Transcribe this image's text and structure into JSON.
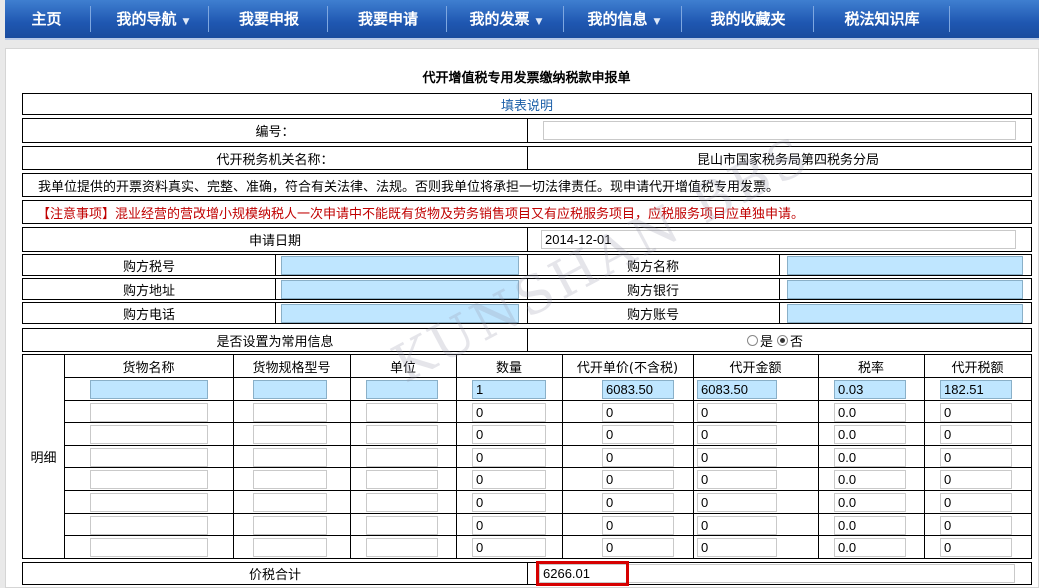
{
  "nav": {
    "items": [
      {
        "label": "主页",
        "dropdown": false
      },
      {
        "label": "我的导航",
        "dropdown": true
      },
      {
        "label": "我要申报",
        "dropdown": false
      },
      {
        "label": "我要申请",
        "dropdown": false
      },
      {
        "label": "我的发票",
        "dropdown": true
      },
      {
        "label": "我的信息",
        "dropdown": true
      },
      {
        "label": "我的收藏夹",
        "dropdown": false
      },
      {
        "label": "税法知识库",
        "dropdown": false
      }
    ]
  },
  "form": {
    "title": "代开增值税专用发票缴纳税款申报单",
    "instructions_link": "填表说明",
    "number_label": "编号：",
    "number_value": "",
    "tax_office_label": "代开税务机关名称：",
    "tax_office_value": "昆山市国家税务局第四税务分局",
    "declaration": "我单位提供的开票资料真实、完整、准确，符合有关法律、法规。否则我单位将承担一切法律责任。现申请代开增值税专用发票。",
    "notice_prefix": "【注意事项】",
    "notice_text": "混业经营的营改增小规模纳税人一次申请中不能既有货物及劳务销售项目又有应税服务项目，应税服务项目应单独申请。",
    "apply_date_label": "申请日期",
    "apply_date_value": "2014-12-01",
    "buyer_tax_no_label": "购方税号",
    "buyer_name_label": "购方名称",
    "buyer_address_label": "购方地址",
    "buyer_bank_label": "购方银行",
    "buyer_phone_label": "购方电话",
    "buyer_account_label": "购方账号",
    "common_info_label": "是否设置为常用信息",
    "radio_yes": "是",
    "radio_no": "否",
    "radio_selected": "否",
    "detail_label": "明细",
    "total_label": "价税合计",
    "total_value": "6266.01"
  },
  "detail": {
    "headers": [
      "货物名称",
      "货物规格型号",
      "单位",
      "数量",
      "代开单价(不含税)",
      "代开金额",
      "税率",
      "代开税额"
    ],
    "rows": [
      [
        "",
        "",
        "",
        "1",
        "6083.50",
        "6083.50",
        "0.03",
        "182.51"
      ],
      [
        "",
        "",
        "",
        "0",
        "0",
        "0",
        "0.0",
        "0"
      ],
      [
        "",
        "",
        "",
        "0",
        "0",
        "0",
        "0.0",
        "0"
      ],
      [
        "",
        "",
        "",
        "0",
        "0",
        "0",
        "0.0",
        "0"
      ],
      [
        "",
        "",
        "",
        "0",
        "0",
        "0",
        "0.0",
        "0"
      ],
      [
        "",
        "",
        "",
        "0",
        "0",
        "0",
        "0.0",
        "0"
      ],
      [
        "",
        "",
        "",
        "0",
        "0",
        "0",
        "0.0",
        "0"
      ],
      [
        "",
        "",
        "",
        "0",
        "0",
        "0",
        "0.0",
        "0"
      ]
    ]
  },
  "watermark": "KUNSHAN BBS",
  "colors": {
    "nav": "#1f57b1",
    "field_blue": "#bfe6ff",
    "notice_red": "#c00000",
    "highlight": "#d60000"
  }
}
